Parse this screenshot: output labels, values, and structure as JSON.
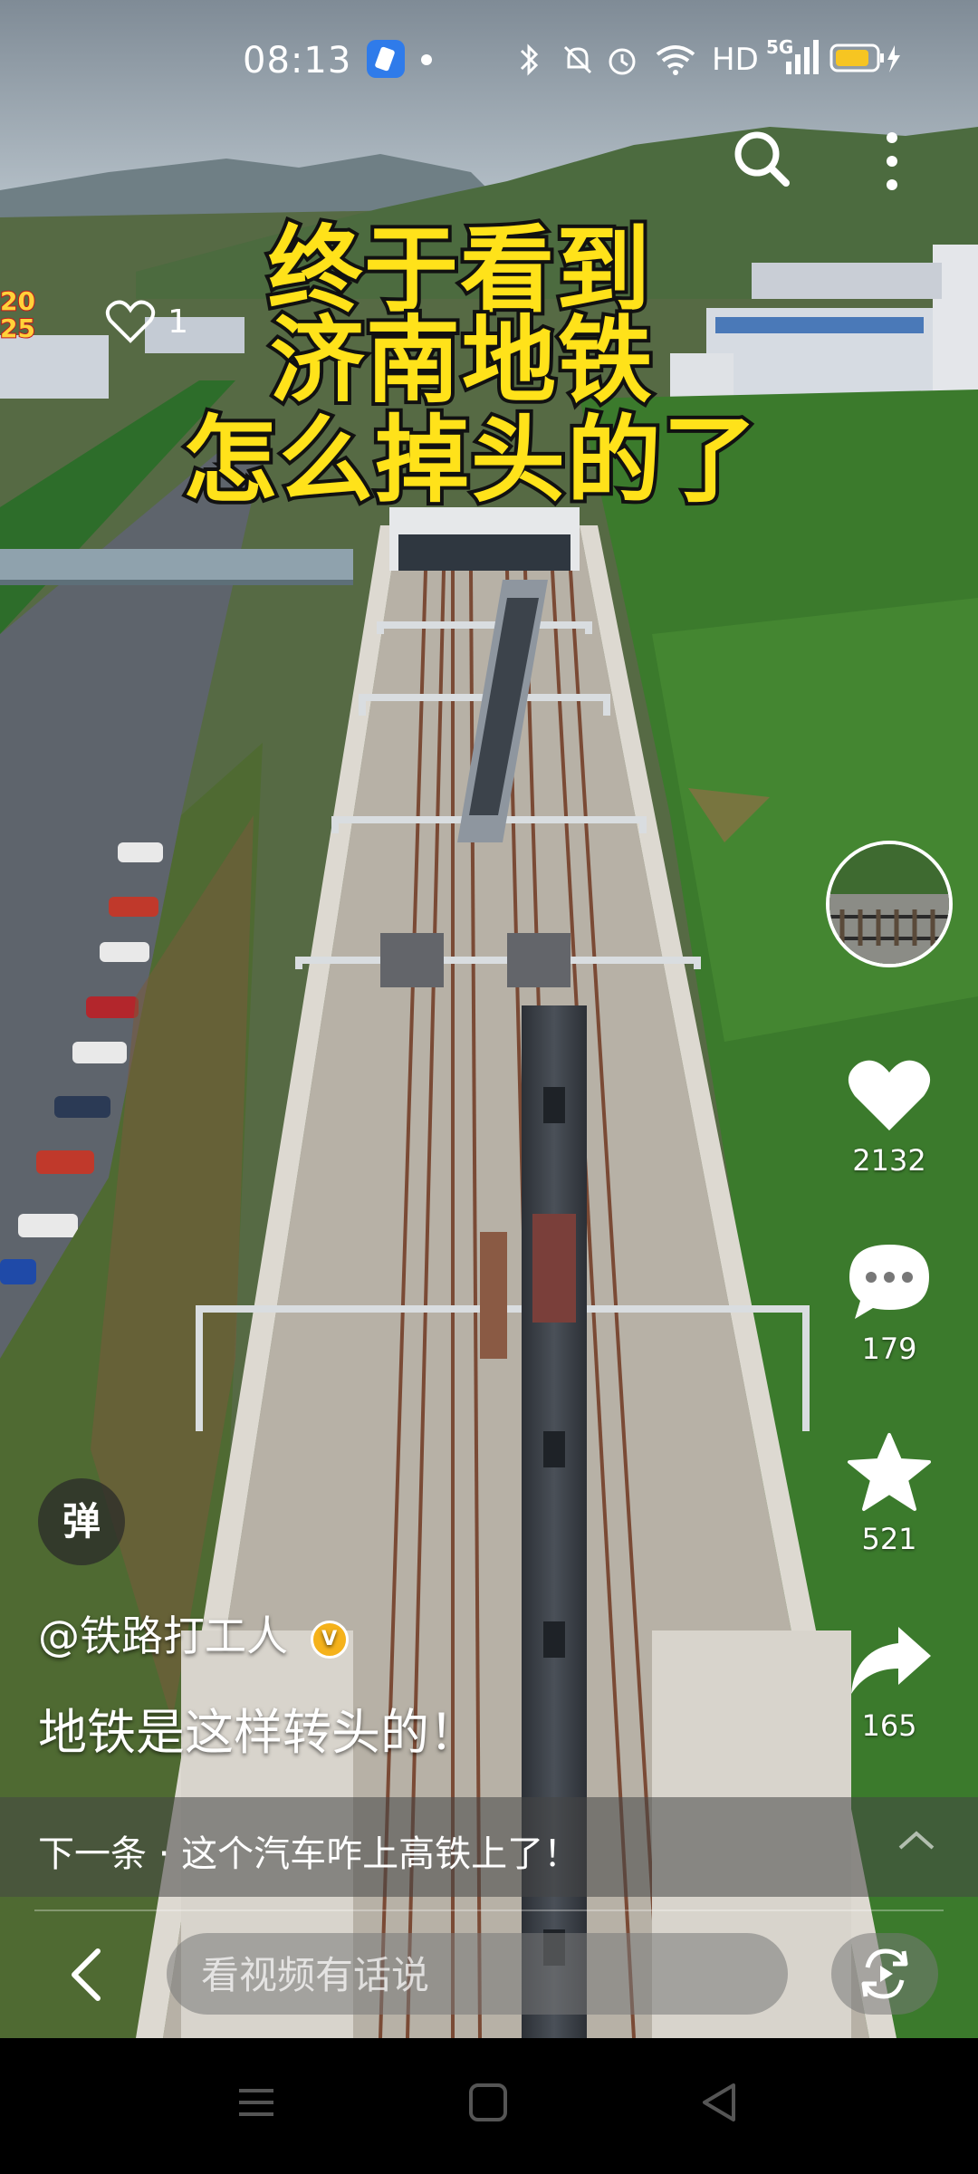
{
  "status_bar": {
    "time": "08:13",
    "hd": "HD",
    "network": "5G"
  },
  "video": {
    "title_lines": [
      "终于看到",
      "济南地铁",
      "怎么掉头的了"
    ],
    "year_badge": [
      "20",
      "25"
    ],
    "mini_like_count": "1"
  },
  "rail": {
    "likes": "2132",
    "comments": "179",
    "favorites": "521",
    "shares": "165"
  },
  "info": {
    "danmaku_label": "弹",
    "author": "@铁路打工人",
    "caption": "地铁是这样转头的！"
  },
  "next": {
    "label": "下一条 · 这个汽车咋上高铁上了！"
  },
  "comment": {
    "placeholder": "看视频有话说"
  },
  "icons": {
    "search": "search-icon",
    "more": "more-vertical-icon",
    "like": "heart-icon",
    "comment": "comment-bubble-icon",
    "favorite": "star-icon",
    "share": "share-arrow-icon",
    "back": "back-arrow-icon",
    "replay": "replay-icon"
  },
  "colors": {
    "title_fill": "#ffe21a",
    "title_stroke": "#111111",
    "verified": "#f5b21b"
  }
}
